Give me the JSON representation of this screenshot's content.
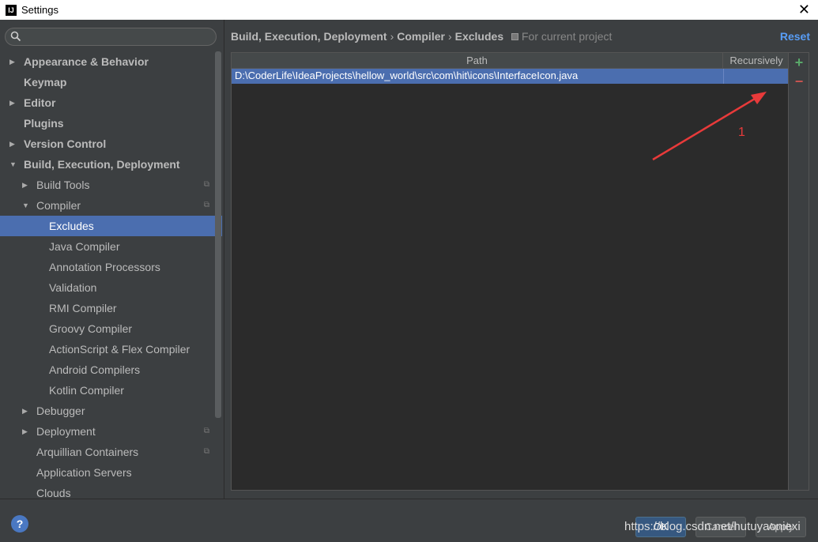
{
  "window": {
    "title": "Settings",
    "logo_text": "IJ",
    "close_glyph": "✕"
  },
  "search": {
    "placeholder": "",
    "value": ""
  },
  "sidebar": {
    "items": [
      {
        "label": "Appearance & Behavior",
        "level": 0,
        "bold": true,
        "arrow": "▶"
      },
      {
        "label": "Keymap",
        "level": 0,
        "bold": true,
        "arrow": ""
      },
      {
        "label": "Editor",
        "level": 0,
        "bold": true,
        "arrow": "▶"
      },
      {
        "label": "Plugins",
        "level": 0,
        "bold": true,
        "arrow": ""
      },
      {
        "label": "Version Control",
        "level": 0,
        "bold": true,
        "arrow": "▶"
      },
      {
        "label": "Build, Execution, Deployment",
        "level": 0,
        "bold": true,
        "arrow": "▼"
      },
      {
        "label": "Build Tools",
        "level": 1,
        "bold": false,
        "arrow": "▶",
        "project": true
      },
      {
        "label": "Compiler",
        "level": 1,
        "bold": false,
        "arrow": "▼",
        "project": true
      },
      {
        "label": "Excludes",
        "level": 2,
        "bold": false,
        "arrow": "",
        "selected": true
      },
      {
        "label": "Java Compiler",
        "level": 2,
        "bold": false,
        "arrow": ""
      },
      {
        "label": "Annotation Processors",
        "level": 2,
        "bold": false,
        "arrow": ""
      },
      {
        "label": "Validation",
        "level": 2,
        "bold": false,
        "arrow": ""
      },
      {
        "label": "RMI Compiler",
        "level": 2,
        "bold": false,
        "arrow": ""
      },
      {
        "label": "Groovy Compiler",
        "level": 2,
        "bold": false,
        "arrow": ""
      },
      {
        "label": "ActionScript & Flex Compiler",
        "level": 2,
        "bold": false,
        "arrow": ""
      },
      {
        "label": "Android Compilers",
        "level": 2,
        "bold": false,
        "arrow": ""
      },
      {
        "label": "Kotlin Compiler",
        "level": 2,
        "bold": false,
        "arrow": ""
      },
      {
        "label": "Debugger",
        "level": 1,
        "bold": false,
        "arrow": "▶"
      },
      {
        "label": "Deployment",
        "level": 1,
        "bold": false,
        "arrow": "▶",
        "project": true
      },
      {
        "label": "Arquillian Containers",
        "level": 1,
        "bold": false,
        "arrow": "",
        "project": true
      },
      {
        "label": "Application Servers",
        "level": 1,
        "bold": false,
        "arrow": ""
      },
      {
        "label": "Clouds",
        "level": 1,
        "bold": false,
        "arrow": ""
      }
    ],
    "project_glyph": "⧉"
  },
  "breadcrumb": {
    "parts": [
      "Build, Execution, Deployment",
      "Compiler",
      "Excludes"
    ],
    "separator": "›",
    "scope": "For current project"
  },
  "reset_label": "Reset",
  "table": {
    "columns": [
      "Path",
      "Recursively"
    ],
    "rows": [
      {
        "path": "D:\\CoderLife\\IdeaProjects\\hellow_world\\src\\com\\hit\\icons\\InterfaceIcon.java",
        "recursively": ""
      }
    ]
  },
  "tools": {
    "add_glyph": "+",
    "remove_glyph": "−"
  },
  "annotation": {
    "label": "1",
    "color": "#e83a3a"
  },
  "footer": {
    "help_glyph": "?",
    "ok_label": "OK",
    "cancel_label": "Cancel",
    "apply_label": "Apply",
    "watermark": "https://blog.csdn.net/hutuyaoniexi"
  },
  "colors": {
    "selection": "#4b6eaf",
    "background": "#3c3f41",
    "link": "#589df6"
  }
}
